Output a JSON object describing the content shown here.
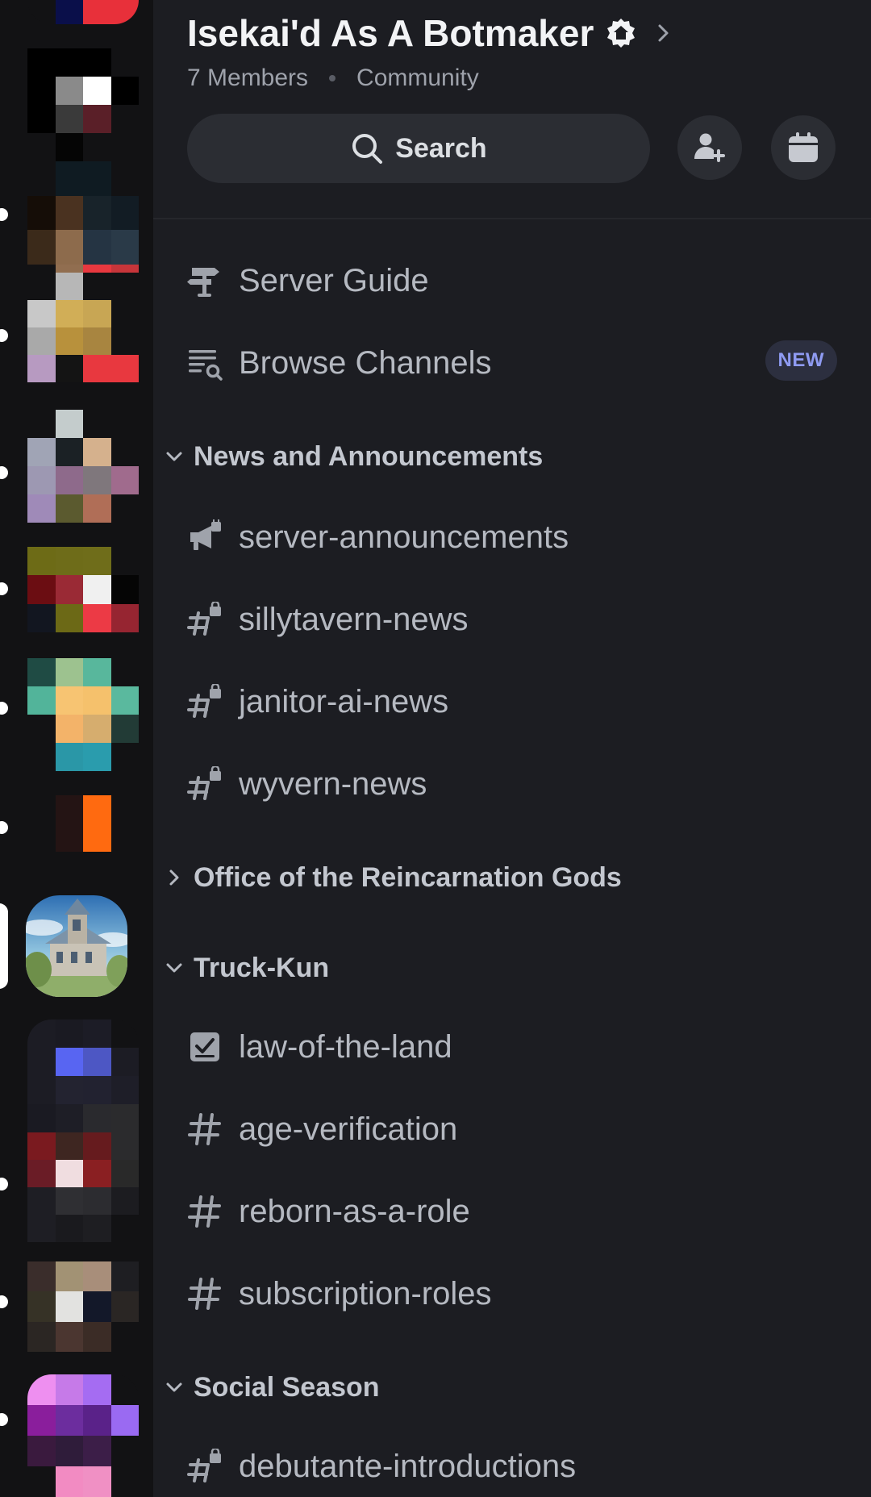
{
  "server": {
    "name": "Isekai'd As A Botmaker",
    "members": "7 Members",
    "type": "Community"
  },
  "search": {
    "label": "Search"
  },
  "nav": {
    "server_guide": "Server Guide",
    "browse_channels": "Browse Channels",
    "new_badge": "NEW"
  },
  "categories": [
    {
      "name": "News and Announcements",
      "expanded": true,
      "channels": [
        "server-announcements",
        "sillytavern-news",
        "janitor-ai-news",
        "wyvern-news"
      ]
    },
    {
      "name": "Office of the Reincarnation Gods",
      "expanded": false,
      "channels": []
    },
    {
      "name": "Truck-Kun",
      "expanded": true,
      "channels": [
        "law-of-the-land",
        "age-verification",
        "reborn-as-a-role",
        "subscription-roles"
      ]
    },
    {
      "name": "Social Season",
      "expanded": true,
      "channels": [
        "debutante-introductions"
      ]
    }
  ],
  "colors": {
    "background": "#1c1d22",
    "rail": "#121214",
    "accent_new": "#8f9bf2",
    "text_channel": "#b5b9c1"
  },
  "icons": {
    "boost_badge": "home-badge-icon",
    "invite": "add-member-icon",
    "events": "calendar-icon",
    "guide": "signpost-icon",
    "browse": "channel-browse-icon",
    "announcement": "megaphone-icon",
    "rules": "checklist-icon",
    "text": "hash-icon",
    "locked_text": "hash-lock-icon"
  }
}
